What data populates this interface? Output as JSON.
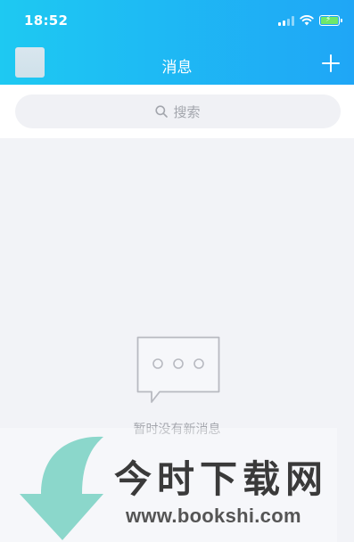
{
  "status_bar": {
    "time": "18:52",
    "signal_icon": "cellular-signal-icon",
    "wifi_icon": "wifi-icon",
    "battery_icon": "battery-charging-icon"
  },
  "nav": {
    "title": "消息",
    "add_icon": "plus-icon",
    "avatar": "user-avatar"
  },
  "search": {
    "placeholder": "搜索",
    "icon": "search-icon"
  },
  "empty_state": {
    "icon": "chat-bubble-icon",
    "text": "暂时没有新消息"
  },
  "watermark": {
    "site_name": "今时下载网",
    "url": "www.bookshi.com",
    "icon": "download-arrow-icon"
  },
  "colors": {
    "header_start": "#1ec9f2",
    "header_end": "#1fa6f6",
    "background": "#f2f3f7",
    "search_bg": "#f0f1f5",
    "muted_text": "#a4a6ad"
  }
}
